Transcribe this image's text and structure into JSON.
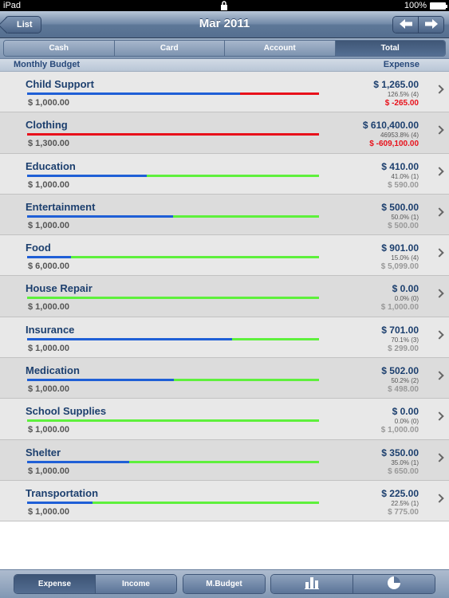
{
  "status_bar": {
    "device": "iPad",
    "battery": "100%"
  },
  "nav": {
    "back_label": "List",
    "title": "Mar 2011",
    "prev_icon": "arrow-left-icon",
    "next_icon": "arrow-right-icon"
  },
  "tabs": [
    {
      "label": "Cash",
      "active": false
    },
    {
      "label": "Card",
      "active": false
    },
    {
      "label": "Account",
      "active": false
    },
    {
      "label": "Total",
      "active": true
    }
  ],
  "section": {
    "left": "Monthly Budget",
    "right": "Expense"
  },
  "colors": {
    "spent": "#1f5fd6",
    "remaining": "#5ef03c",
    "over": "#e8101a"
  },
  "rows": [
    {
      "name": "Child Support",
      "budget": "$ 1,000.00",
      "expense": "$ 1,265.00",
      "pct": "126.5% (4)",
      "remain": "$ -265.00",
      "over": true,
      "spent_fraction": 0.73
    },
    {
      "name": "Clothing",
      "budget": "$ 1,300.00",
      "expense": "$ 610,400.00",
      "pct": "46953.8% (4)",
      "remain": "$ -609,100.00",
      "over": true,
      "spent_fraction": 0.0
    },
    {
      "name": "Education",
      "budget": "$ 1,000.00",
      "expense": "$ 410.00",
      "pct": "41.0% (1)",
      "remain": "$ 590.00",
      "over": false,
      "spent_fraction": 0.41
    },
    {
      "name": "Entertainment",
      "budget": "$ 1,000.00",
      "expense": "$ 500.00",
      "pct": "50.0% (1)",
      "remain": "$ 500.00",
      "over": false,
      "spent_fraction": 0.5
    },
    {
      "name": "Food",
      "budget": "$ 6,000.00",
      "expense": "$ 901.00",
      "pct": "15.0% (4)",
      "remain": "$ 5,099.00",
      "over": false,
      "spent_fraction": 0.15
    },
    {
      "name": "House Repair",
      "budget": "$ 1,000.00",
      "expense": "$ 0.00",
      "pct": "0.0% (0)",
      "remain": "$ 1,000.00",
      "over": false,
      "spent_fraction": 0.0
    },
    {
      "name": "Insurance",
      "budget": "$ 1,000.00",
      "expense": "$ 701.00",
      "pct": "70.1% (3)",
      "remain": "$ 299.00",
      "over": false,
      "spent_fraction": 0.701
    },
    {
      "name": "Medication",
      "budget": "$ 1,000.00",
      "expense": "$ 502.00",
      "pct": "50.2% (2)",
      "remain": "$ 498.00",
      "over": false,
      "spent_fraction": 0.502
    },
    {
      "name": "School Supplies",
      "budget": "$ 1,000.00",
      "expense": "$ 0.00",
      "pct": "0.0% (0)",
      "remain": "$ 1,000.00",
      "over": false,
      "spent_fraction": 0.0
    },
    {
      "name": "Shelter",
      "budget": "$ 1,000.00",
      "expense": "$ 350.00",
      "pct": "35.0% (1)",
      "remain": "$ 650.00",
      "over": false,
      "spent_fraction": 0.35
    },
    {
      "name": "Transportation",
      "budget": "$ 1,000.00",
      "expense": "$ 225.00",
      "pct": "22.5% (1)",
      "remain": "$ 775.00",
      "over": false,
      "spent_fraction": 0.225
    }
  ],
  "toolbar": {
    "group1": [
      {
        "label": "Expense",
        "active": true
      },
      {
        "label": "Income",
        "active": false
      }
    ],
    "mbudget_label": "M.Budget",
    "chart_icons": [
      "bar-chart-icon",
      "pie-chart-icon"
    ]
  }
}
